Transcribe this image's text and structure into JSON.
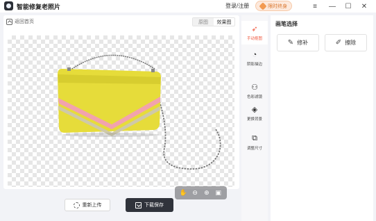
{
  "app": {
    "title": "智能修复老照片",
    "login_label": "登录/注册",
    "vip_label": "限时终身",
    "accent_color": "#f0553b"
  },
  "window_controls": {
    "menu_icon": "≡",
    "minimize_icon": "—",
    "maximize_icon": "☐",
    "close_icon": "✕"
  },
  "editor": {
    "back_label": "返回首页",
    "view_tabs": [
      {
        "label": "原图",
        "active": false
      },
      {
        "label": "效果图",
        "active": true
      }
    ],
    "zoom_controls": [
      "hand-icon",
      "zoom-out-icon",
      "zoom-in-icon",
      "fit-icon"
    ]
  },
  "actions": {
    "reupload_label": "重新上传",
    "download_label": "下载保存"
  },
  "tools": [
    {
      "label": "手动抠图",
      "icon": "cursor-icon",
      "active": true
    },
    {
      "label": "阴影描边",
      "icon": "shadow-icon",
      "active": false
    },
    {
      "label": "色彩滤镜",
      "icon": "color-filter-icon",
      "active": false
    },
    {
      "label": "更换背景",
      "icon": "paint-bucket-icon",
      "active": false
    },
    {
      "label": "调整尺寸",
      "icon": "resize-icon",
      "active": false
    }
  ],
  "brush": {
    "title": "画笔选择",
    "buttons": [
      {
        "label": "修补",
        "icon": "brush-icon"
      },
      {
        "label": "擦除",
        "icon": "eraser-icon"
      }
    ]
  },
  "image": {
    "subject": "yellow-handbag",
    "bag_color": "#e6dc3a",
    "stripe_color": "#f2a3ad"
  }
}
